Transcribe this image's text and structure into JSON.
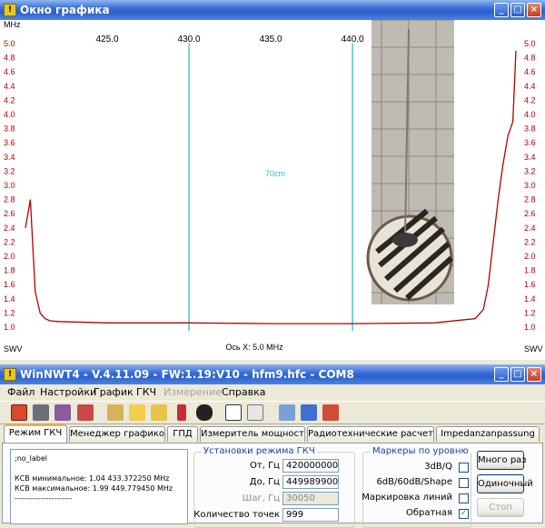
{
  "graph_window": {
    "title": "Окно графика",
    "x_unit": "MHz",
    "x_ticks": [
      "425.0",
      "430.0",
      "435.0",
      "440.0"
    ],
    "y_ticks": [
      "5.0",
      "4.8",
      "4.6",
      "4.4",
      "4.2",
      "4.0",
      "3.8",
      "3.6",
      "3.4",
      "3.2",
      "3.0",
      "2.8",
      "2.6",
      "2.4",
      "2.2",
      "2.0",
      "1.8",
      "1.6",
      "1.4",
      "1.2",
      "1.0"
    ],
    "y_label_left": "SWV",
    "y_label_right": "SWV",
    "axis_caption": "Ось X: 5.0 MHz",
    "marker_text": "70cm",
    "colors": {
      "trace": "#b40000",
      "marker": "#35b9c6",
      "grid": "#d9d9d9",
      "tick_text": "#b40000"
    }
  },
  "chart_data": {
    "type": "line",
    "xlabel": "Ось X: 5.0 MHz",
    "ylabel": "SWV",
    "xlim": [
      420.0,
      449.99
    ],
    "ylim": [
      1.0,
      5.0
    ],
    "grid": false,
    "annotations": [
      "70cm"
    ],
    "markers_mhz": [
      430.0,
      440.0
    ],
    "series": [
      {
        "x": [
          420.0,
          420.3,
          420.6,
          420.9,
          421.2,
          421.5,
          422.0,
          425.0,
          430.0,
          435.0,
          440.0,
          445.0,
          447.5,
          448.0,
          448.3,
          448.6,
          448.9,
          449.2,
          449.5,
          449.8,
          449.99
        ],
        "y": [
          2.4,
          2.8,
          1.5,
          1.2,
          1.12,
          1.09,
          1.08,
          1.06,
          1.06,
          1.05,
          1.05,
          1.06,
          1.12,
          1.25,
          1.6,
          2.2,
          2.8,
          3.3,
          3.7,
          3.9,
          4.9
        ]
      }
    ]
  },
  "app_window": {
    "title": "WinNWT4 - V.4.11.09 - FW:1.19:V10 - hfm9.hfc - COM8",
    "menu": [
      "Файл",
      "Настройки",
      "График",
      "ГКЧ",
      "Измерение",
      "Справка"
    ],
    "toolbar_icons": [
      "power-icon",
      "printer-icon",
      "printer-color-icon",
      "calculator-icon",
      "tools-icon",
      "envelope-icon",
      "envelope-open-icon",
      "pen-icon",
      "penguin-icon",
      "chart-icon",
      "chart-settings-icon",
      "pencil-icon",
      "save-icon",
      "delete-icon"
    ],
    "tabs": [
      "Режим ГКЧ",
      "Менеджер графиков",
      "ГПД",
      "Измеритель мощности",
      "Радиотехнические расчеты",
      "Impedanzanpassung"
    ],
    "memo_lines": [
      ";no_label",
      "",
      "КСВ минимальное: 1.04  433.372250 MHz",
      "КСВ максимальное: 1.99  449.779450 MHz",
      "----------------------"
    ],
    "sweep_group": {
      "legend": "Установки режима ГКЧ",
      "from_label": "От, Гц",
      "from_value": "420000000",
      "to_label": "До, Гц",
      "to_value": "449989900",
      "step_label": "Шаг, Гц",
      "step_value": "30050",
      "points_label": "Количество точек",
      "points_value": "999"
    },
    "markers_group": {
      "legend": "Маркеры по уровню",
      "m1": "3dB/Q",
      "m2": "6dB/60dB/Shape",
      "m3": "Маркировка линий",
      "m4": "Обратная",
      "m4_checked": "✓"
    },
    "buttons": {
      "multi": "Много раз",
      "single": "Одиночный",
      "stop": "Стоп"
    }
  }
}
